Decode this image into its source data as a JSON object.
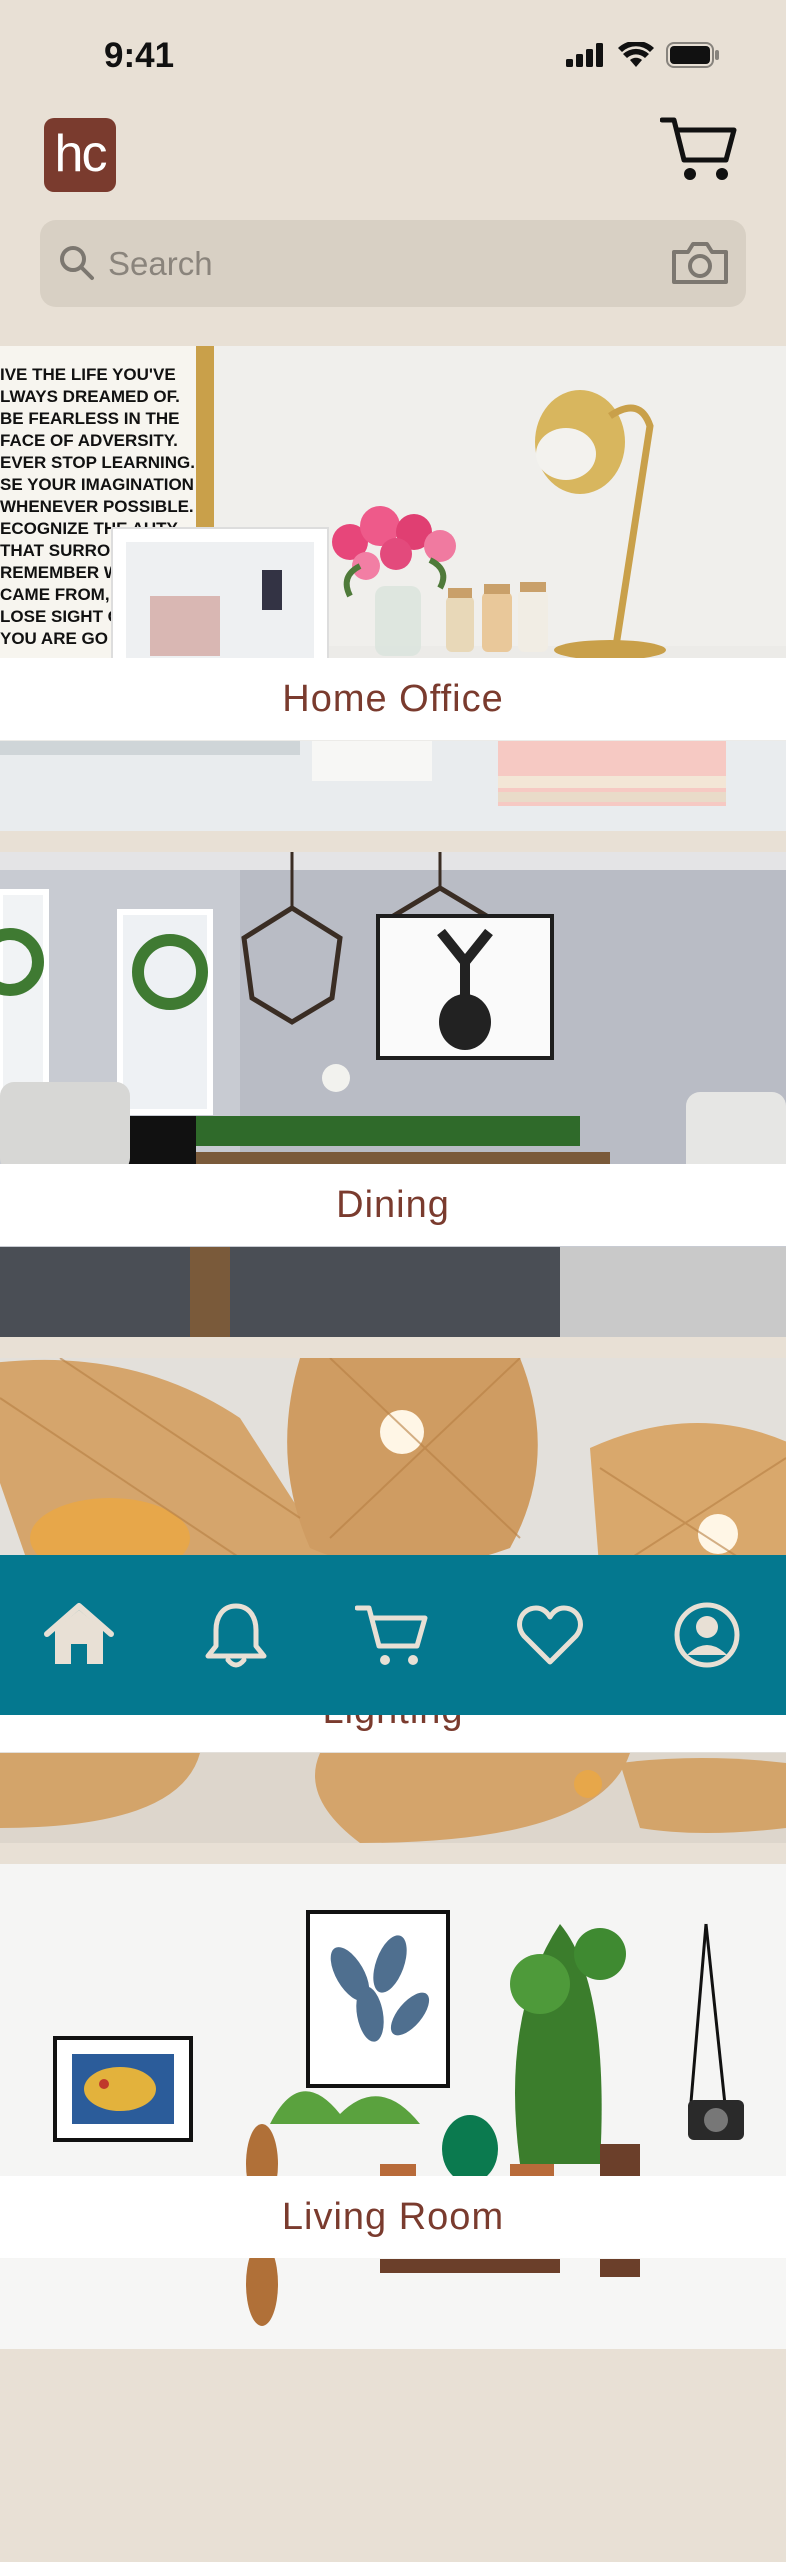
{
  "status_bar": {
    "time": "9:41"
  },
  "header": {
    "logo_text": "hc"
  },
  "search": {
    "placeholder": "Search"
  },
  "categories": [
    {
      "label": "Home Office"
    },
    {
      "label": "Dining"
    },
    {
      "label": "Lighting"
    },
    {
      "label": "Living Room"
    }
  ],
  "home_office_poster_lines": [
    "IVE THE LIFE YOU'VE",
    "LWAYS DREAMED OF.",
    "BE FEARLESS IN THE",
    "FACE OF ADVERSITY.",
    "EVER STOP LEARNING.",
    "SE YOUR IMAGINATION",
    "WHENEVER POSSIBLE.",
    "ECOGNIZE THE   AUTY",
    "THAT SURROUN",
    "REMEMBER WH",
    "CAME FROM, BU",
    "LOSE SIGHT OF",
    "YOU ARE GO"
  ],
  "tabbar": {
    "items": [
      {
        "name": "home",
        "icon": "home-icon"
      },
      {
        "name": "notifications",
        "icon": "bell-icon"
      },
      {
        "name": "cart",
        "icon": "cart-icon"
      },
      {
        "name": "favorites",
        "icon": "heart-icon"
      },
      {
        "name": "profile",
        "icon": "profile-icon"
      }
    ]
  },
  "colors": {
    "background": "#e8e0d5",
    "brand": "#7a3b2e",
    "tabbar": "#04788f",
    "search_bg": "#d8d0c4"
  }
}
